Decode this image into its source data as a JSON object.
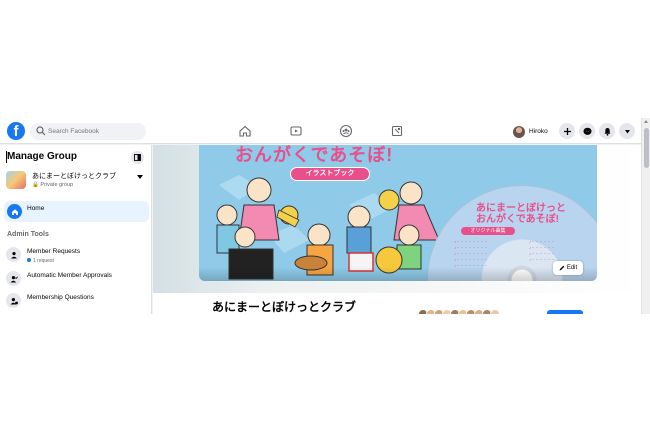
{
  "search": {
    "placeholder": "Search Facebook"
  },
  "top_nav": {
    "icons": [
      "home-icon",
      "watch-icon",
      "groups-icon",
      "gaming-icon"
    ],
    "profile_name": "Hiroko",
    "actions": [
      "create-icon",
      "messenger-icon",
      "notifications-icon",
      "account-menu-icon"
    ]
  },
  "sidebar": {
    "title": "Manage Group",
    "group": {
      "name": "あにまーとぼけっとクラブ",
      "privacy": "Private group"
    },
    "home_label": "Home",
    "admin_tools_heading": "Admin Tools",
    "admin_items": [
      {
        "label": "Member Requests",
        "sub": "1 request",
        "icon": "person-icon"
      },
      {
        "label": "Automatic Member Approvals",
        "sub": "",
        "icon": "person-check-icon"
      },
      {
        "label": "Membership Questions",
        "sub": "",
        "icon": "person-question-icon"
      }
    ]
  },
  "cover": {
    "heading": "おんがくであそぼ!",
    "tag": "イラストブック",
    "cd_title_line1": "あにまーとぼけっと",
    "cd_title_line2": "おんがくであそぼ!",
    "cd_band": "オリジナル曲集",
    "edit_label": "Edit"
  },
  "main": {
    "group_title": "あにまーとぼけっとクラブ"
  },
  "colors": {
    "brand": "#1877f2",
    "accent_pink": "#e8508c",
    "background": "#f0f2f5"
  }
}
